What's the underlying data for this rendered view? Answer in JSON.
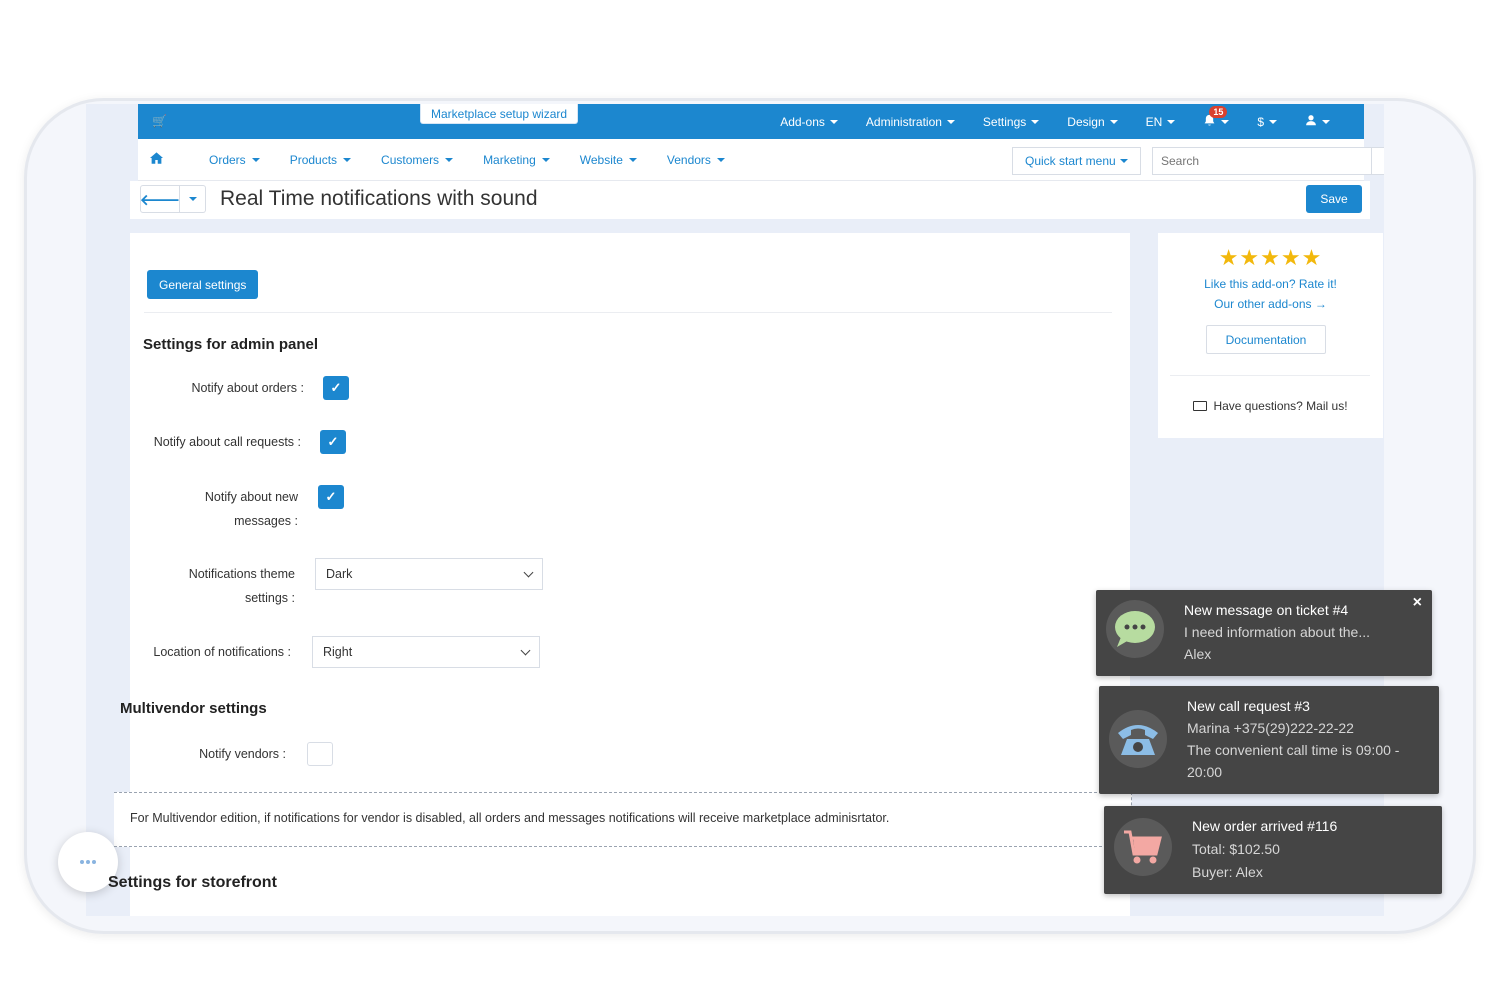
{
  "topbar": {
    "wizard": "Marketplace setup wizard",
    "items": [
      {
        "label": "Add-ons"
      },
      {
        "label": "Administration"
      },
      {
        "label": "Settings"
      },
      {
        "label": "Design"
      },
      {
        "label": "EN"
      }
    ],
    "notification_count": "15",
    "currency": "$"
  },
  "subnav": {
    "items": [
      {
        "label": "Orders"
      },
      {
        "label": "Products"
      },
      {
        "label": "Customers"
      },
      {
        "label": "Marketing"
      },
      {
        "label": "Website"
      },
      {
        "label": "Vendors"
      }
    ],
    "quick_start": "Quick start menu",
    "search_placeholder": "Search"
  },
  "titlebar": {
    "title": "Real Time notifications with sound",
    "save": "Save"
  },
  "main": {
    "tab": "General settings",
    "admin_section": "Settings for admin panel",
    "notify_orders": {
      "label": "Notify about orders :",
      "checked": true
    },
    "notify_calls": {
      "label": "Notify about call requests :",
      "checked": true
    },
    "notify_messages": {
      "label_line1": "Notify about new",
      "label_line2": "messages :",
      "checked": true
    },
    "theme": {
      "label_line1": "Notifications theme",
      "label_line2": "settings :",
      "value": "Dark"
    },
    "location": {
      "label": "Location of notifications :",
      "value": "Right"
    },
    "multivendor_section": "Multivendor settings",
    "notify_vendors": {
      "label": "Notify vendors :",
      "checked": false
    },
    "note": "For Multivendor edition, if notifications for vendor is disabled, all orders and messages notifications will receive marketplace adminisrtator.",
    "storefront_section": "Settings for storefront"
  },
  "side": {
    "stars": "★★★★★",
    "rate": "Like this add-on? Rate it!",
    "other": "Our other add-ons →",
    "docs": "Documentation",
    "mail": "Have questions? Mail us!"
  },
  "notifications": [
    {
      "title": "New message on ticket #4",
      "line1": "I need information about the...",
      "line2": "Alex",
      "icon": "chat-bubble-icon",
      "color": "#b7dca0"
    },
    {
      "title": "New call request #3",
      "line1": "Marina +375(29)222-22-22",
      "line2": "The convenient call time is 09:00 -",
      "line3": "20:00",
      "icon": "telephone-icon",
      "color": "#8cbde6"
    },
    {
      "title": "New order arrived #116",
      "line1": "Total: $102.50",
      "line2": "Buyer: Alex",
      "icon": "shopping-cart-icon",
      "color": "#f3a8a3"
    }
  ],
  "colors": {
    "accent": "#1c87cf",
    "toast_bg": "#454545",
    "star": "#f2b80c"
  }
}
